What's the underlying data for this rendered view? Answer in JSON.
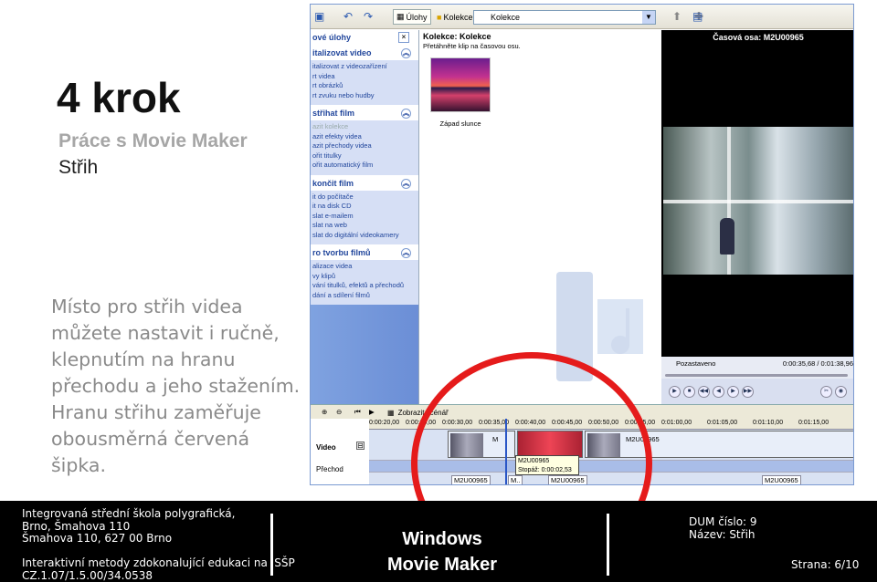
{
  "slide": {
    "title": "4 krok",
    "subtitle1": "Práce s Movie Maker",
    "subtitle2": "Střih",
    "body_lines": [
      "Místo pro střih videa",
      "můžete nastavit i ručně,",
      "klepnutím na hranu",
      "přechodu a jeho stažením.",
      "Hranu střihu zaměřuje",
      "obousměrná červená",
      "šipka."
    ]
  },
  "app": {
    "toolbar": {
      "tasks_label": "Úlohy",
      "collections_label": "Kolekce",
      "combo_value": "Kolekce"
    },
    "task_pane": {
      "header": "ové úlohy",
      "sections": [
        {
          "title": "italizovat video",
          "items": [
            "italizovat z videozařízení",
            "rt videa",
            "rt obrázků",
            "rt zvuku nebo hudby"
          ]
        },
        {
          "title": "střihat film",
          "items": [
            "azit kolekce",
            "azit efekty videa",
            "azit přechody videa",
            "ořit titulky",
            "ořit automatický film"
          ]
        },
        {
          "title": "končit film",
          "items": [
            "it do počítače",
            "it na disk CD",
            "slat e-mailem",
            "slat na web",
            "slat do digitální videokamery"
          ]
        },
        {
          "title": "ro tvorbu filmů",
          "items": [
            "alizace videa",
            "vy klipů",
            "vání titulků, efektů a přechodů",
            "dání a sdílení filmů"
          ]
        }
      ]
    },
    "collection": {
      "title": "Kolekce: Kolekce",
      "hint": "Přetáhněte klip na časovou osu.",
      "clip_label": "Západ slunce"
    },
    "preview": {
      "header": "Časová osa: M2U00965",
      "status": "Pozastaveno",
      "timecode": "0:00:35,68 / 0:01:38,96"
    },
    "timeline": {
      "show_storyboard": "Zobrazit scénář",
      "ruler": [
        "0:00:20,00",
        "0:00:25,00",
        "0:00:30,00",
        "0:00:35,00",
        "0:00:40,00",
        "0:00:45,00",
        "0:00:50,00",
        "0:00:55,00",
        "0:01:00,00",
        "0:01:05,00",
        "0:01:10,00",
        "0:01:15,00"
      ],
      "row_video": "Video",
      "row_transition": "Přechod",
      "clips": [
        "M",
        "M2U00965"
      ],
      "tooltip_name": "M2U00965",
      "tooltip_duration": "Stopáž: 0:00:02,53",
      "bottom_clips": [
        "M2U00965",
        "M..",
        "M2U00965",
        "M2U00965"
      ]
    }
  },
  "footer": {
    "school1": "Integrovaná střední škola polygrafická,",
    "school2": "Brno, Šmahova 110",
    "school3": "Šmahova 110, 627 00 Brno",
    "project1": "Interaktivní metody zdokonalující edukaci na ISŠP",
    "project2": "CZ.1.07/1.5.00/34.0538",
    "center1": "Windows",
    "center2": "Movie Maker",
    "dum": "DUM číslo: 9",
    "name": "Název: Střih",
    "page": "Strana: 6/10"
  }
}
